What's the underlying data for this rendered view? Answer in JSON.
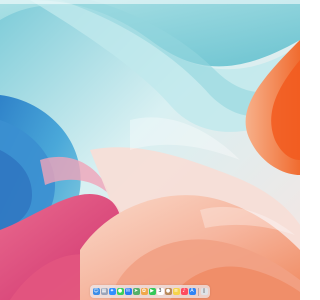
{
  "desktop": {
    "wallpaper": "abstract-wave-wallpaper",
    "colors": {
      "teal": "#78c9d6",
      "light_teal": "#cdeef1",
      "blue": "#3d8fd0",
      "pink": "#e97a9b",
      "magenta": "#d9477a",
      "orange": "#f2874b",
      "peach": "#f6c7b5",
      "cream": "#f8ebe8"
    }
  },
  "dock": {
    "items": [
      {
        "name": "finder-icon",
        "color": "#3b8ee8",
        "glyph": "☺"
      },
      {
        "name": "launchpad-icon",
        "color": "#9aa4b8",
        "glyph": "▦"
      },
      {
        "name": "safari-icon",
        "color": "#2f8fff",
        "glyph": "✦"
      },
      {
        "name": "messages-icon",
        "color": "#3ccf5a",
        "glyph": "●"
      },
      {
        "name": "mail-icon",
        "color": "#2c7cf2",
        "glyph": "✉"
      },
      {
        "name": "maps-icon",
        "color": "#55b06a",
        "glyph": "➤"
      },
      {
        "name": "photos-icon",
        "color": "#f0a84a",
        "glyph": "✿"
      },
      {
        "name": "facetime-icon",
        "color": "#34c759",
        "glyph": "▶"
      },
      {
        "name": "calendar-icon",
        "color": "#ffffff",
        "glyph": "3"
      },
      {
        "name": "contacts-icon",
        "color": "#b98a5a",
        "glyph": "●"
      },
      {
        "name": "notes-icon",
        "color": "#f6d34a",
        "glyph": "≡"
      },
      {
        "name": "music-icon",
        "color": "#ff4a5f",
        "glyph": "♪"
      },
      {
        "name": "app-store-icon",
        "color": "#2f84f5",
        "glyph": "A"
      }
    ],
    "trash": {
      "name": "trash-icon",
      "color": "#dfe3e8",
      "glyph": "▯"
    }
  }
}
